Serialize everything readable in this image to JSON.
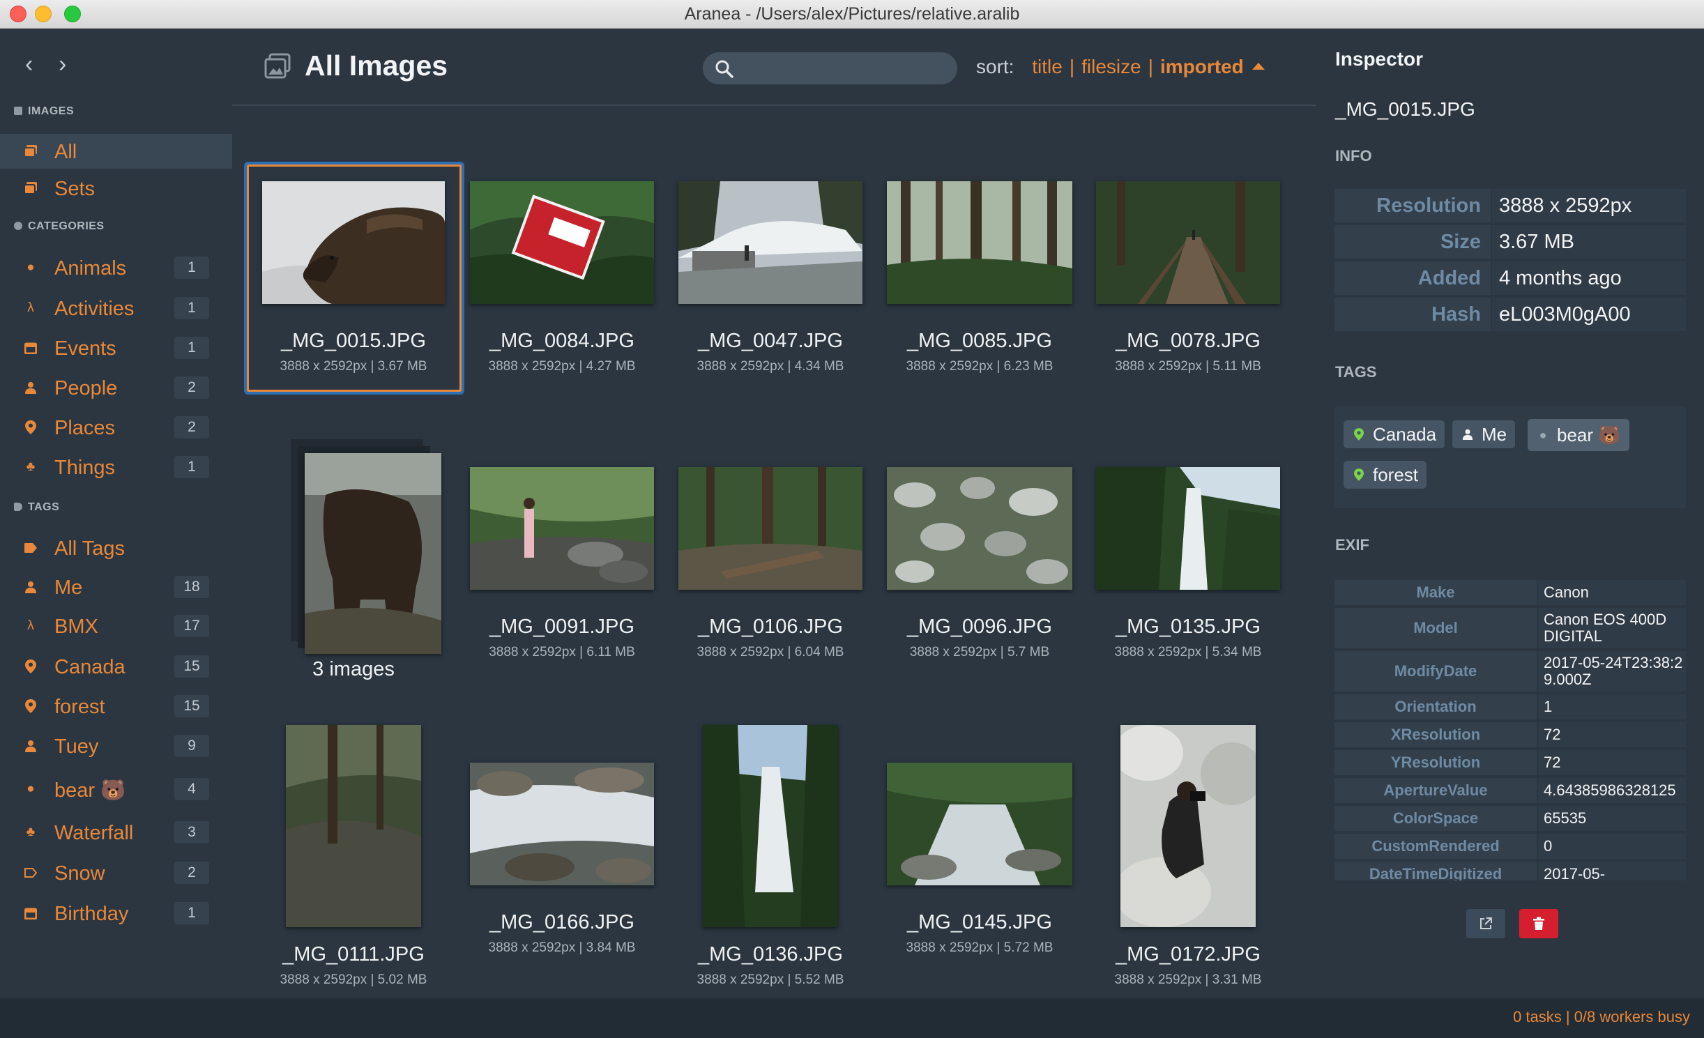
{
  "window": {
    "title": "Aranea - /Users/alex/Pictures/relative.aralib"
  },
  "sidebar": {
    "images_heading": "IMAGES",
    "image_items": [
      {
        "label": "All",
        "icon": "images-icon"
      },
      {
        "label": "Sets",
        "icon": "images-icon"
      }
    ],
    "categories_heading": "CATEGORIES",
    "categories": [
      {
        "label": "Animals",
        "count": "1",
        "icon": "paw-icon"
      },
      {
        "label": "Activities",
        "count": "1",
        "icon": "running-icon"
      },
      {
        "label": "Events",
        "count": "1",
        "icon": "calendar-icon"
      },
      {
        "label": "People",
        "count": "2",
        "icon": "person-icon"
      },
      {
        "label": "Places",
        "count": "2",
        "icon": "map-pin-icon"
      },
      {
        "label": "Things",
        "count": "1",
        "icon": "puzzle-icon"
      }
    ],
    "tags_heading": "TAGS",
    "all_tags_label": "All Tags",
    "tags": [
      {
        "label": "Me",
        "count": "18",
        "icon": "person-icon"
      },
      {
        "label": "BMX",
        "count": "17",
        "icon": "running-icon"
      },
      {
        "label": "Canada",
        "count": "15",
        "icon": "map-pin-icon"
      },
      {
        "label": "forest",
        "count": "15",
        "icon": "map-pin-icon"
      },
      {
        "label": "Tuey",
        "count": "9",
        "icon": "person-icon"
      },
      {
        "label": "bear 🐻",
        "count": "4",
        "icon": "paw-icon"
      },
      {
        "label": "Waterfall",
        "count": "3",
        "icon": "puzzle-icon"
      },
      {
        "label": "Snow",
        "count": "2",
        "icon": "tag-icon"
      },
      {
        "label": "Birthday",
        "count": "1",
        "icon": "calendar-icon"
      }
    ]
  },
  "main": {
    "title": "All Images",
    "search": {
      "value": "",
      "placeholder": ""
    },
    "sort": {
      "label": "sort:",
      "options": [
        "title",
        "filesize",
        "imported"
      ],
      "active": "imported",
      "separator": "|"
    },
    "images": [
      {
        "name": "_MG_0015.JPG",
        "meta": "3888 x 2592px | 3.67 MB",
        "selected": true
      },
      {
        "name": "_MG_0084.JPG",
        "meta": "3888 x 2592px | 4.27 MB"
      },
      {
        "name": "_MG_0047.JPG",
        "meta": "3888 x 2592px | 4.34 MB"
      },
      {
        "name": "_MG_0085.JPG",
        "meta": "3888 x 2592px | 6.23 MB"
      },
      {
        "name": "_MG_0078.JPG",
        "meta": "3888 x 2592px | 5.11 MB"
      },
      {
        "name": "3 images",
        "meta": ""
      },
      {
        "name": "_MG_0091.JPG",
        "meta": "3888 x 2592px | 6.11 MB"
      },
      {
        "name": "_MG_0106.JPG",
        "meta": "3888 x 2592px | 6.04 MB"
      },
      {
        "name": "_MG_0096.JPG",
        "meta": "3888 x 2592px | 5.7 MB"
      },
      {
        "name": "_MG_0135.JPG",
        "meta": "3888 x 2592px | 5.34 MB"
      },
      {
        "name": "_MG_0111.JPG",
        "meta": "3888 x 2592px | 5.02 MB"
      },
      {
        "name": "_MG_0166.JPG",
        "meta": "3888 x 2592px | 3.84 MB"
      },
      {
        "name": "_MG_0136.JPG",
        "meta": "3888 x 2592px | 5.52 MB"
      },
      {
        "name": "_MG_0145.JPG",
        "meta": "3888 x 2592px | 5.72 MB"
      },
      {
        "name": "_MG_0172.JPG",
        "meta": "3888 x 2592px | 3.31 MB"
      }
    ]
  },
  "inspector": {
    "title": "Inspector",
    "filename": "_MG_0015.JPG",
    "info_heading": "INFO",
    "info": [
      {
        "key": "Resolution",
        "value": "3888 x 2592px"
      },
      {
        "key": "Size",
        "value": "3.67 MB"
      },
      {
        "key": "Added",
        "value": "4 months ago"
      },
      {
        "key": "Hash",
        "value": "eL003M0gA00"
      }
    ],
    "tags_heading": "TAGS",
    "tags": [
      {
        "label": "Canada",
        "icon": "map-pin-icon"
      },
      {
        "label": "Me",
        "icon": "person-icon"
      },
      {
        "label": "bear 🐻",
        "icon": "paw-icon"
      },
      {
        "label": "forest",
        "icon": "map-pin-icon"
      }
    ],
    "exif_heading": "EXIF",
    "exif": [
      {
        "key": "Make",
        "value": "Canon"
      },
      {
        "key": "Model",
        "value": "Canon EOS 400D DIGITAL"
      },
      {
        "key": "ModifyDate",
        "value": "2017-05-24T23:38:29.000Z"
      },
      {
        "key": "Orientation",
        "value": "1"
      },
      {
        "key": "XResolution",
        "value": "72"
      },
      {
        "key": "YResolution",
        "value": "72"
      },
      {
        "key": "ApertureValue",
        "value": "4.64385986328125"
      },
      {
        "key": "ColorSpace",
        "value": "65535"
      },
      {
        "key": "CustomRendered",
        "value": "0"
      },
      {
        "key": "DateTimeDigitized",
        "value": "2017-05-"
      }
    ]
  },
  "status": {
    "text": "0 tasks | 0/8 workers busy"
  },
  "colors": {
    "accent": "#e8883a",
    "background": "#2b3640",
    "selection": "#2d6fb3",
    "danger": "#d51f2f"
  }
}
